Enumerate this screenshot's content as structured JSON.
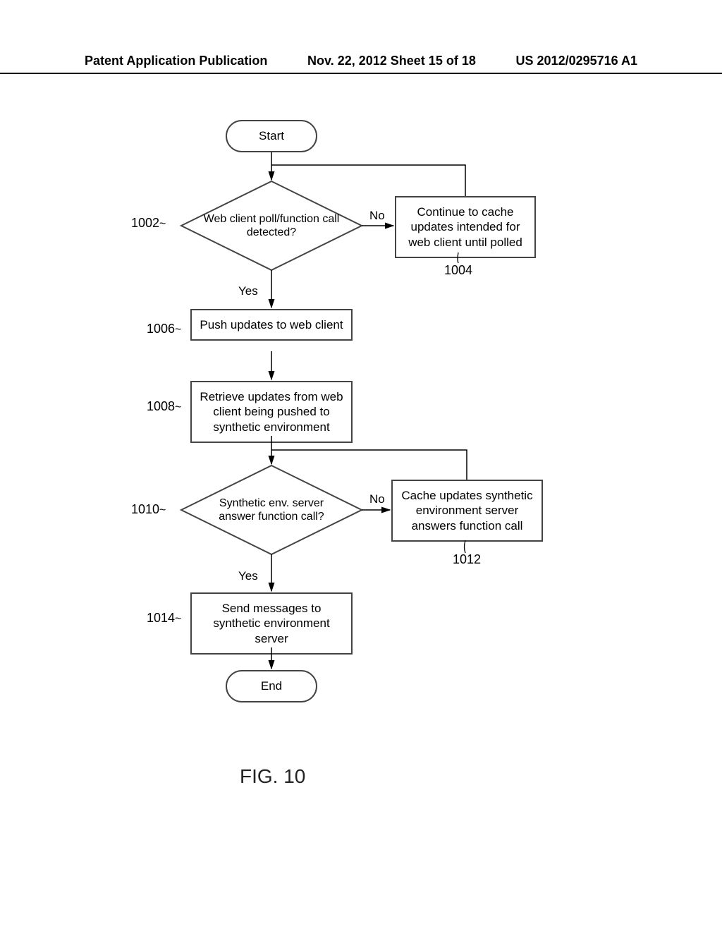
{
  "header": {
    "left": "Patent Application Publication",
    "center": "Nov. 22, 2012  Sheet 15 of 18",
    "right": "US 2012/0295716 A1"
  },
  "nodes": {
    "start": "Start",
    "d1002": "Web client poll/function call detected?",
    "p1004": "Continue to cache updates intended for web client until polled",
    "p1006": "Push updates to web client",
    "p1008": "Retrieve updates from web client being pushed to synthetic environment",
    "d1010": "Synthetic env. server answer function call?",
    "p1012": "Cache updates synthetic environment server answers function call",
    "p1014": "Send messages to synthetic environment server",
    "end": "End"
  },
  "edges": {
    "yes1": "Yes",
    "no1": "No",
    "yes2": "Yes",
    "no2": "No"
  },
  "refs": {
    "r1002": "1002",
    "r1004": "1004",
    "r1006": "1006",
    "r1008": "1008",
    "r1010": "1010",
    "r1012": "1012",
    "r1014": "1014"
  },
  "figure": "FIG. 10"
}
